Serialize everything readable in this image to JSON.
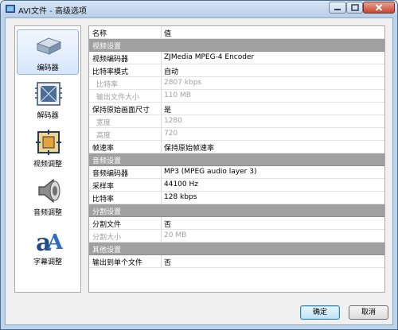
{
  "window": {
    "title": "AVI文件 - 高级选项"
  },
  "sidebar": {
    "items": [
      {
        "label": "编码器",
        "icon": "encoder-device-icon",
        "selected": true
      },
      {
        "label": "解码器",
        "icon": "decoder-chip-icon",
        "selected": false
      },
      {
        "label": "视频调整",
        "icon": "video-adjust-icon",
        "selected": false
      },
      {
        "label": "音频调整",
        "icon": "speaker-icon",
        "selected": false
      },
      {
        "label": "字幕调整",
        "icon": "subtitle-font-icon",
        "selected": false
      }
    ]
  },
  "grid": {
    "columns": {
      "name": "名称",
      "value": "值"
    },
    "rows": [
      {
        "type": "category",
        "name": "视频设置",
        "value": ""
      },
      {
        "type": "item",
        "name": "视频编码器",
        "value": "ZJMedia MPEG-4 Encoder"
      },
      {
        "type": "item",
        "name": "比特率模式",
        "value": "自动"
      },
      {
        "type": "sub-disabled",
        "name": "比特率",
        "value": "2807 kbps"
      },
      {
        "type": "sub-disabled",
        "name": "输出文件大小",
        "value": "110 MB"
      },
      {
        "type": "item",
        "name": "保持原始画面尺寸",
        "value": "是"
      },
      {
        "type": "sub-disabled",
        "name": "宽度",
        "value": "1280"
      },
      {
        "type": "sub-disabled",
        "name": "高度",
        "value": "720"
      },
      {
        "type": "item",
        "name": "帧速率",
        "value": "保持原始帧速率"
      },
      {
        "type": "category",
        "name": "音频设置",
        "value": ""
      },
      {
        "type": "item",
        "name": "音频编码器",
        "value": "MP3 (MPEG audio layer 3)"
      },
      {
        "type": "item",
        "name": "采样率",
        "value": "44100 Hz"
      },
      {
        "type": "item",
        "name": "比特率",
        "value": "128 kbps"
      },
      {
        "type": "category",
        "name": "分割设置",
        "value": ""
      },
      {
        "type": "item",
        "name": "分割文件",
        "value": "否"
      },
      {
        "type": "disabled",
        "name": "分割大小",
        "value": "20 MB"
      },
      {
        "type": "category",
        "name": "其他设置",
        "value": ""
      },
      {
        "type": "item",
        "name": "输出到单个文件",
        "value": "否"
      }
    ]
  },
  "buttons": {
    "ok": "确定",
    "cancel": "取消"
  },
  "colors": {
    "category_bg": "#a0a0a0",
    "selection_bg": "#d6e6fb",
    "disabled_text": "#a0a0a0"
  }
}
